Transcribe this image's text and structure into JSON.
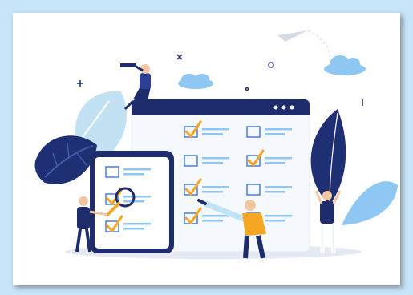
{
  "illustration": {
    "subject": "checklist-survey-scene",
    "colors": {
      "navy": "#1f2c6b",
      "accent_orange": "#f5a623",
      "checkbox_blue": "#4a7fe0",
      "light_blue": "#8ec7f2",
      "leaf_dark": "#1e2f73",
      "leaf_light": "#bfe3f7"
    },
    "board_checklist": {
      "rows": [
        {
          "left_checked": true,
          "right_checked": false
        },
        {
          "left_checked": false,
          "right_checked": true
        },
        {
          "left_checked": true,
          "right_checked": false
        },
        {
          "left_checked": true,
          "right_checked": false
        }
      ]
    },
    "phone_checklist": {
      "rows": [
        {
          "checked": false
        },
        {
          "checked": true
        },
        {
          "checked": true
        }
      ]
    }
  }
}
